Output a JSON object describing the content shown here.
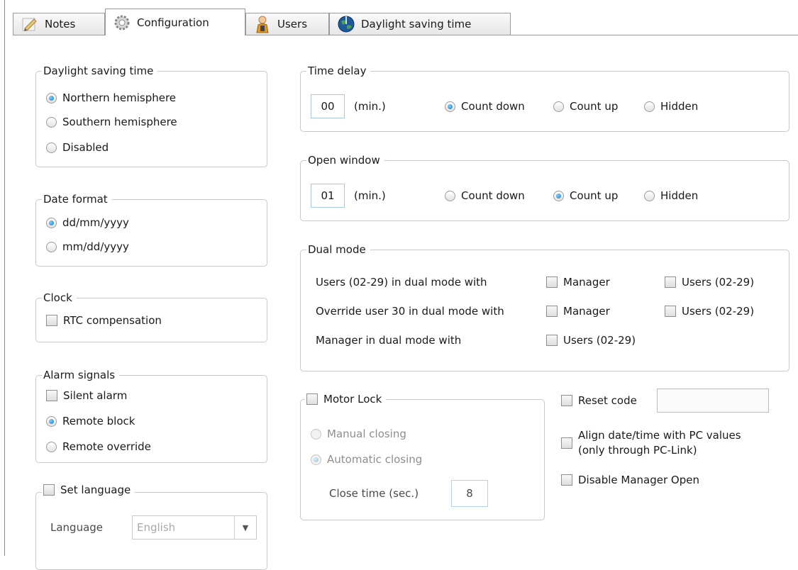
{
  "tabs": [
    {
      "label": "Notes",
      "icon": "notes-pencil-icon"
    },
    {
      "label": "Configuration",
      "icon": "gear-icon"
    },
    {
      "label": "Users",
      "icon": "user-icon"
    },
    {
      "label": "Daylight saving time",
      "icon": "globe-icon"
    }
  ],
  "active_tab": "Configuration",
  "daylight": {
    "title": "Daylight saving time",
    "options": [
      "Northern hemisphere",
      "Southern hemisphere",
      "Disabled"
    ],
    "selected": "Northern hemisphere"
  },
  "date_format": {
    "title": "Date format",
    "options": [
      "dd/mm/yyyy",
      "mm/dd/yyyy"
    ],
    "selected": "dd/mm/yyyy"
  },
  "clock": {
    "title": "Clock",
    "rtc_label": "RTC compensation",
    "rtc_checked": false
  },
  "alarm": {
    "title": "Alarm signals",
    "silent_label": "Silent alarm",
    "silent_checked": false,
    "options": [
      "Remote block",
      "Remote override"
    ],
    "selected": "Remote block"
  },
  "language": {
    "title": "Set language",
    "checked": false,
    "label": "Language",
    "value": "English"
  },
  "time_delay": {
    "title": "Time delay",
    "value": "00",
    "unit": "(min.)",
    "options": [
      "Count down",
      "Count up",
      "Hidden"
    ],
    "selected": "Count down"
  },
  "open_window": {
    "title": "Open window",
    "value": "01",
    "unit": "(min.)",
    "options": [
      "Count down",
      "Count up",
      "Hidden"
    ],
    "selected": "Count up"
  },
  "dual_mode": {
    "title": "Dual mode",
    "rows": [
      {
        "label": "Users (02-29) in dual mode with",
        "opt1": "Manager",
        "opt2": "Users (02-29)"
      },
      {
        "label": "Override user 30 in dual mode with",
        "opt1": "Manager",
        "opt2": "Users (02-29)"
      },
      {
        "label": "Manager in dual mode with",
        "opt1": "Users (02-29)",
        "opt2": ""
      }
    ]
  },
  "motor_lock": {
    "title": "Motor Lock",
    "checked": false,
    "options": [
      "Manual closing",
      "Automatic closing"
    ],
    "selected": "Automatic closing",
    "close_time_label": "Close time (sec.)",
    "close_time_value": "8"
  },
  "reset_code": {
    "label": "Reset code",
    "value": ""
  },
  "align_date": {
    "line1": "Align date/time with PC values",
    "line2": "(only through PC-Link)"
  },
  "disable_manager": {
    "label": "Disable Manager Open"
  },
  "colors": {
    "accent": "#1878c6",
    "border": "#c9c9c9"
  }
}
